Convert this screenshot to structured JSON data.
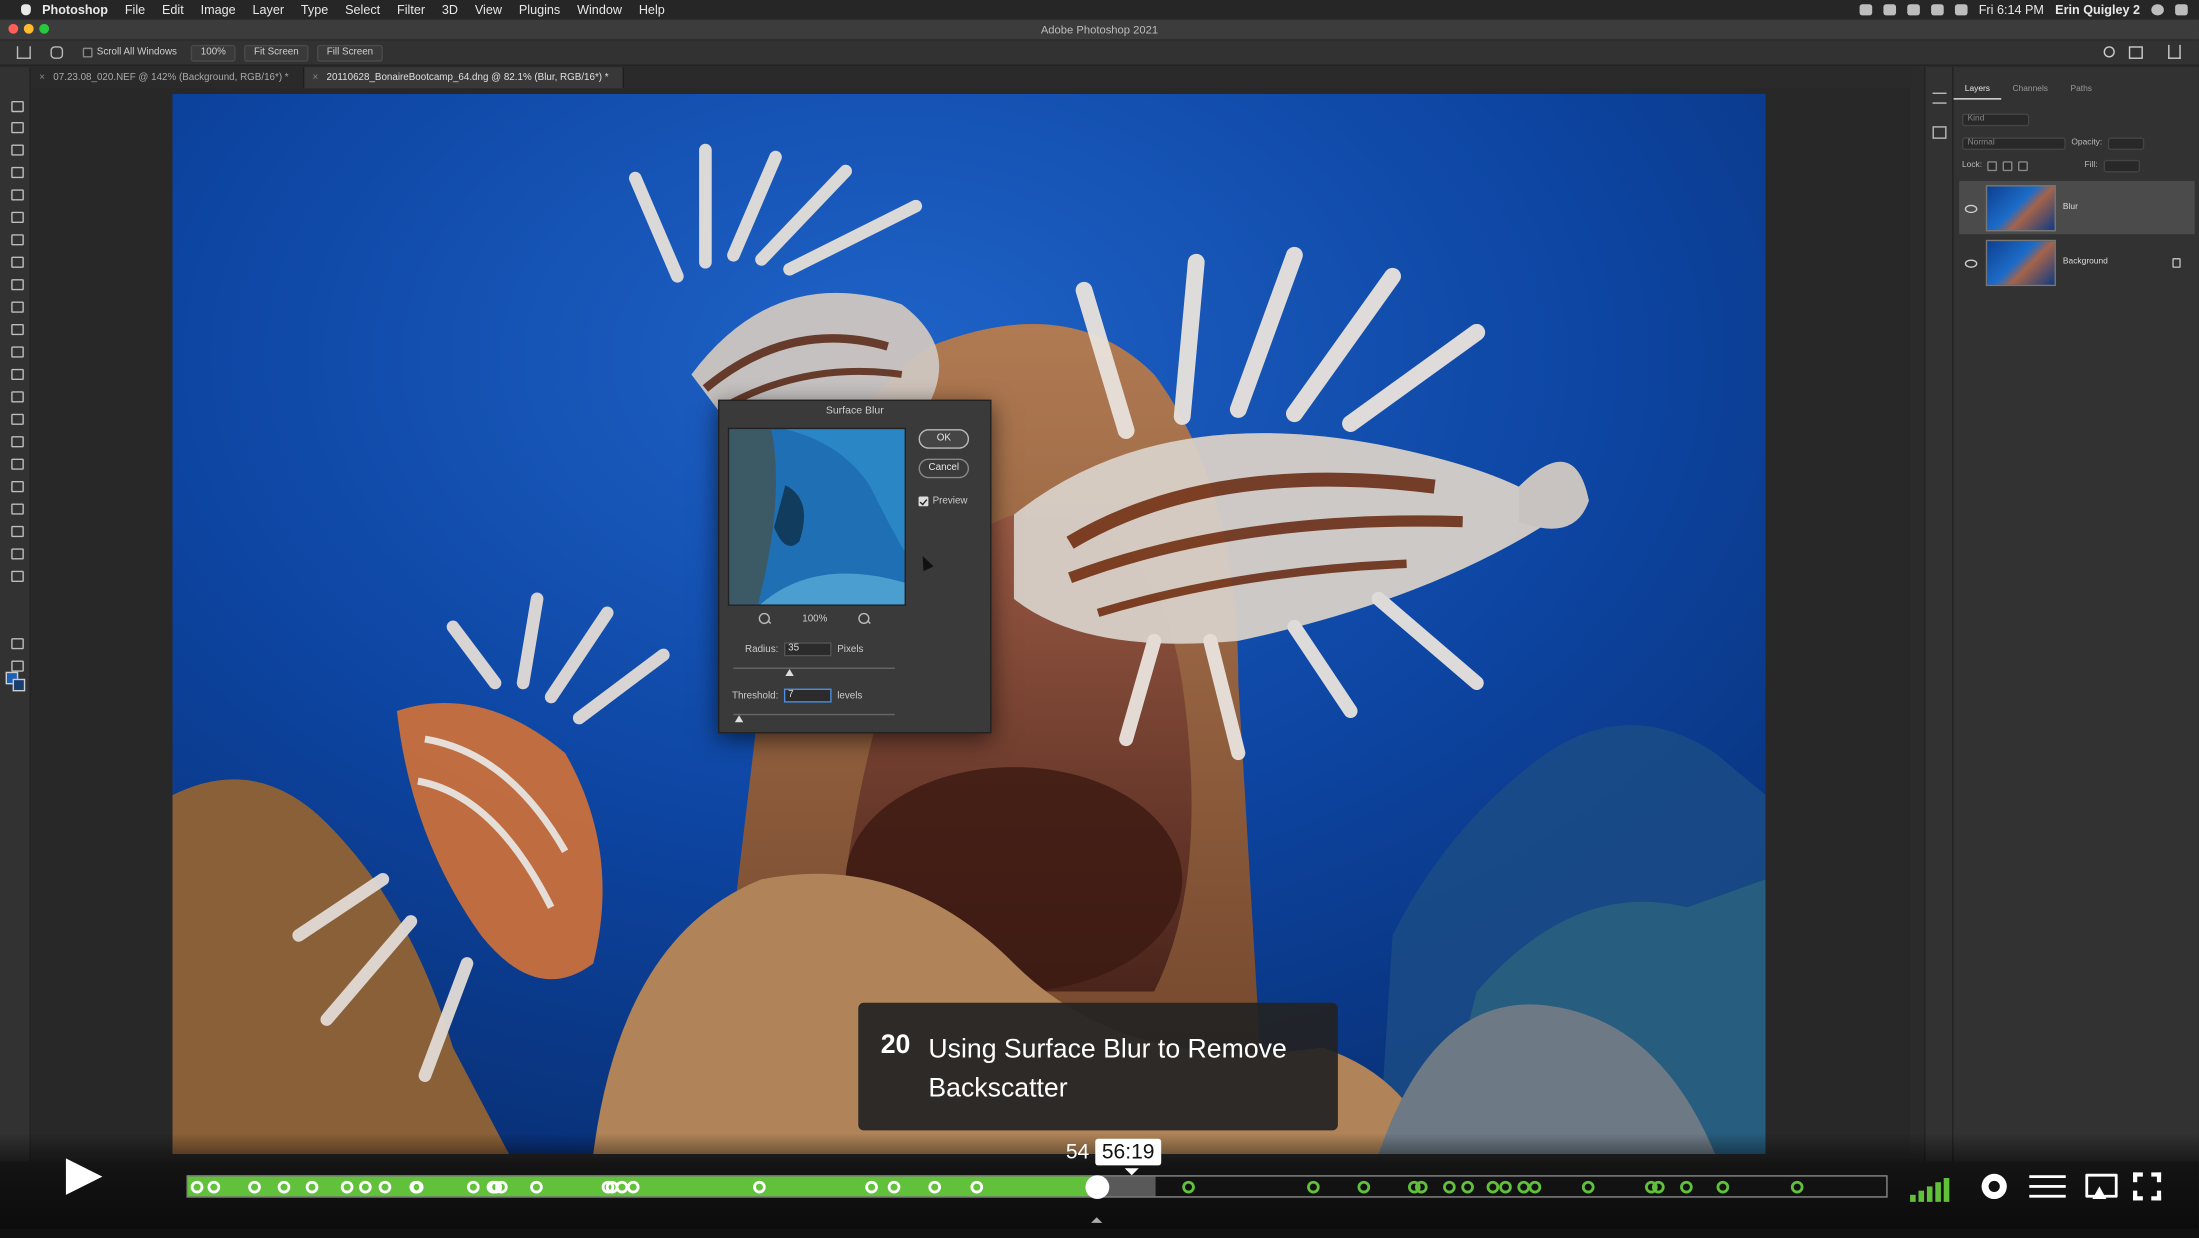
{
  "menubar": {
    "app": "Photoshop",
    "items": [
      "File",
      "Edit",
      "Image",
      "Layer",
      "Type",
      "Select",
      "Filter",
      "3D",
      "View",
      "Plugins",
      "Window",
      "Help"
    ],
    "clock": "Fri 6:14 PM",
    "user": "Erin Quigley 2"
  },
  "window": {
    "title": "Adobe Photoshop 2021"
  },
  "options_bar": {
    "scroll_all": "Scroll All Windows",
    "zoom": "100%",
    "fit_screen": "Fit Screen",
    "fill_screen": "Fill Screen"
  },
  "tabs": [
    {
      "label": "07.23.08_020.NEF @ 142% (Background, RGB/16*) *"
    },
    {
      "label": "20110628_BonaireBootcamp_64.dng @ 82.1% (Blur, RGB/16*) *"
    }
  ],
  "layers_panel": {
    "tabs": [
      "Layers",
      "Channels",
      "Paths"
    ],
    "kind": "Kind",
    "blend_mode": "Normal",
    "opacity_label": "Opacity:",
    "lock_label": "Lock:",
    "fill_label": "Fill:",
    "layers": [
      {
        "name": "Blur",
        "active": true
      },
      {
        "name": "Background",
        "active": false
      }
    ]
  },
  "dialog": {
    "title": "Surface Blur",
    "ok": "OK",
    "cancel": "Cancel",
    "preview": "Preview",
    "zoom": "100%",
    "radius_label": "Radius:",
    "radius_value": "35",
    "radius_unit": "Pixels",
    "threshold_label": "Threshold:",
    "threshold_value": "7",
    "threshold_unit": "levels"
  },
  "lesson": {
    "number": "20",
    "title": "Using Surface Blur to Remove Backscatter"
  },
  "player": {
    "time_before": "54",
    "time_current": "56:19",
    "progress": 0.535,
    "chapters": [
      0.005,
      0.015,
      0.039,
      0.056,
      0.073,
      0.093,
      0.104,
      0.116,
      0.135,
      0.134,
      0.168,
      0.179,
      0.181,
      0.184,
      0.205,
      0.247,
      0.249,
      0.255,
      0.262,
      0.336,
      0.402,
      0.415,
      0.439,
      0.464,
      0.589,
      0.662,
      0.692,
      0.722,
      0.726,
      0.742,
      0.753,
      0.768,
      0.775,
      0.786,
      0.793,
      0.824,
      0.861,
      0.865,
      0.882,
      0.903,
      0.947
    ]
  },
  "colors": {
    "accent": "#61c13b",
    "fg_swatch": "#1a5fb8",
    "bg_swatch": "#1a3d70"
  }
}
